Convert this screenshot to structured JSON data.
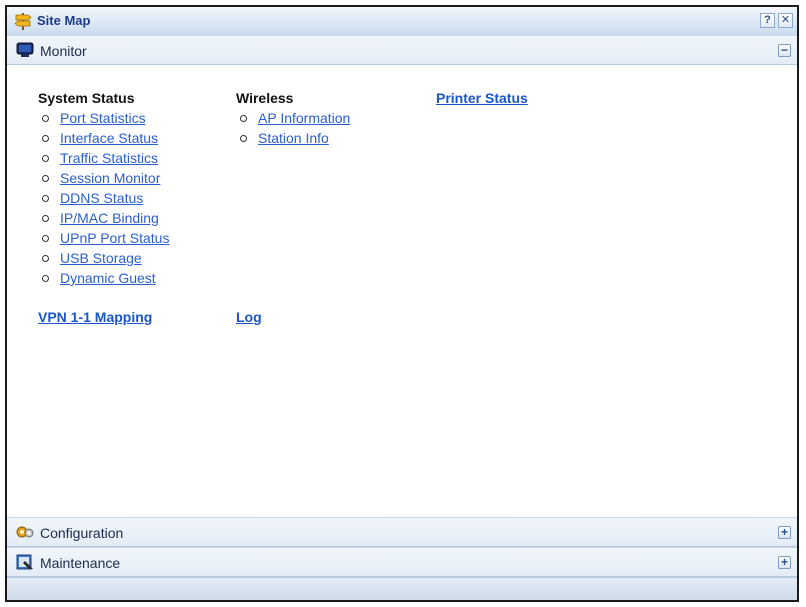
{
  "window": {
    "title": "Site Map",
    "help_label": "?",
    "close_label": "✕"
  },
  "monitor": {
    "label": "Monitor",
    "toggle": "−",
    "system_status": {
      "title": "System Status",
      "items": [
        "Port Statistics",
        "Interface Status",
        "Traffic Statistics",
        "Session Monitor",
        "DDNS Status",
        "IP/MAC Binding",
        "UPnP Port Status",
        "USB Storage",
        "Dynamic Guest"
      ]
    },
    "wireless": {
      "title": "Wireless",
      "items": [
        "AP Information",
        "Station Info"
      ]
    },
    "printer_status": "Printer Status",
    "vpn_mapping": "VPN 1-1 Mapping",
    "log": "Log"
  },
  "configuration": {
    "label": "Configuration",
    "toggle": "+"
  },
  "maintenance": {
    "label": "Maintenance",
    "toggle": "+"
  },
  "colors": {
    "link": "#2a5fd0",
    "header_bg": "#e3ecf6",
    "title_text": "#1d3b8c"
  },
  "icons": {
    "title": "signpost-icon",
    "monitor": "monitor-icon",
    "configuration": "gears-icon",
    "maintenance": "maintenance-icon"
  }
}
